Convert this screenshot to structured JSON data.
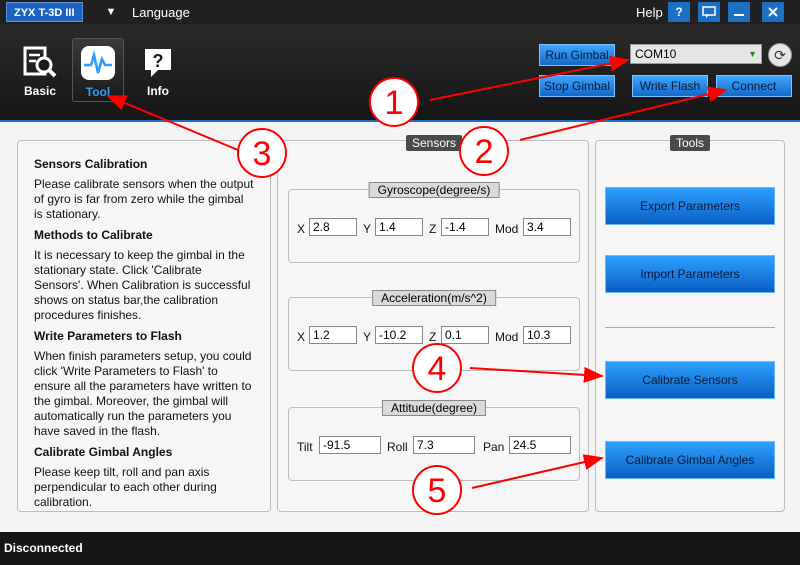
{
  "titlebar": {
    "app_title": "ZYX T-3D III",
    "language_label": "Language",
    "help_label": "Help",
    "help_icon": "?"
  },
  "nav": {
    "tabs": [
      {
        "label": "Basic",
        "icon": "magnifier-document-icon"
      },
      {
        "label": "Tool",
        "icon": "waveform-icon"
      },
      {
        "label": "Info",
        "icon": "question-bubble-icon"
      }
    ]
  },
  "controls": {
    "run_gimbal": "Run Gimbal",
    "stop_gimbal": "Stop Gimbal",
    "write_flash": "Write Flash",
    "connect": "Connect",
    "com_port": "COM10"
  },
  "info_panel": {
    "sections": [
      {
        "heading": "Sensors Calibration",
        "text": "Please calibrate sensors when the output of gyro is far from zero while the gimbal is stationary."
      },
      {
        "heading": "Methods to Calibrate",
        "text": "It is necessary to keep the gimbal in the stationary state. Click 'Calibrate Sensors'. When Calibration is successful shows on status bar,the calibration procedures finishes."
      },
      {
        "heading": "Write Parameters to Flash",
        "text": "When finish parameters setup, you could click 'Write Parameters to Flash' to ensure all the parameters have written to the gimbal. Moreover, the gimbal will automatically run the parameters you have saved in the flash."
      },
      {
        "heading": "Calibrate Gimbal Angles",
        "text": "Please keep tilt, roll and pan axis perpendicular to each other during calibration."
      }
    ]
  },
  "sensors": {
    "title": "Sensors",
    "gyroscope": {
      "title": "Gyroscope(degree/s)",
      "x_label": "X",
      "y_label": "Y",
      "z_label": "Z",
      "mod_label": "Mod",
      "x": "2.8",
      "y": "1.4",
      "z": "-1.4",
      "mod": "3.4"
    },
    "acceleration": {
      "title": "Acceleration(m/s^2)",
      "x_label": "X",
      "y_label": "Y",
      "z_label": "Z",
      "mod_label": "Mod",
      "x": "1.2",
      "y": "-10.2",
      "z": "0.1",
      "mod": "10.3"
    },
    "attitude": {
      "title": "Attitude(degree)",
      "tilt_label": "Tilt",
      "roll_label": "Roll",
      "pan_label": "Pan",
      "tilt": "-91.5",
      "roll": "7.3",
      "pan": "24.5"
    }
  },
  "tools": {
    "title": "Tools",
    "export": "Export Parameters",
    "import": "Import Parameters",
    "calibrate_sensors": "Calibrate Sensors",
    "calibrate_angles": "Calibrate Gimbal Angles"
  },
  "status": {
    "text": "Disconnected"
  },
  "callouts": [
    "1",
    "2",
    "3",
    "4",
    "5"
  ],
  "colors": {
    "accent": "#1e6fc4",
    "annotation": "#ff0000"
  }
}
